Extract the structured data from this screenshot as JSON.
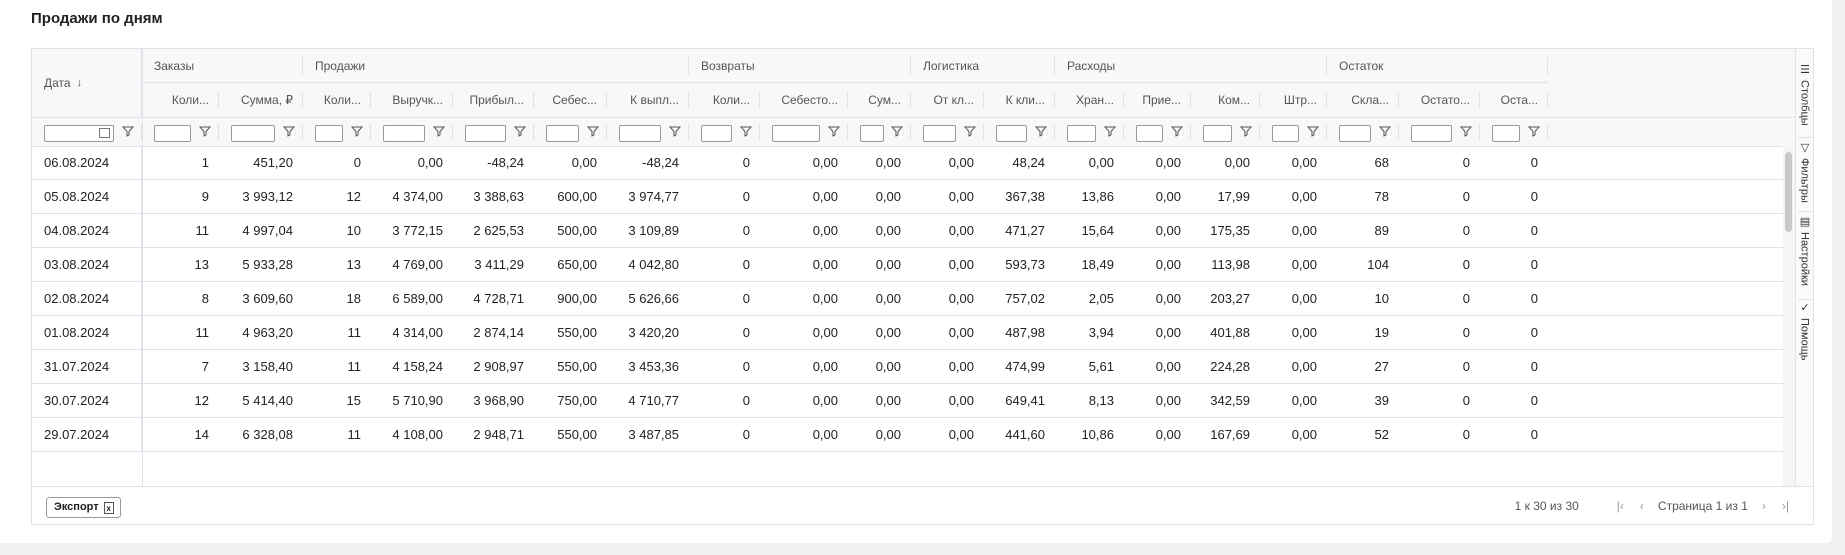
{
  "page": {
    "title": "Продажи по дням"
  },
  "groups": [
    {
      "label": "Заказы",
      "key": "orders"
    },
    {
      "label": "Продажи",
      "key": "sales"
    },
    {
      "label": "Возвраты",
      "key": "returns"
    },
    {
      "label": "Логистика",
      "key": "logistics"
    },
    {
      "label": "Расходы",
      "key": "expenses"
    },
    {
      "label": "Остаток",
      "key": "stock"
    }
  ],
  "date_column": {
    "label": "Дата",
    "sort_icon": "arrow-down-icon"
  },
  "columns": [
    {
      "label": "Коли..."
    },
    {
      "label": "Сумма, ₽"
    },
    {
      "label": "Коли..."
    },
    {
      "label": "Выручк..."
    },
    {
      "label": "Прибыл..."
    },
    {
      "label": "Себес..."
    },
    {
      "label": "К выпл..."
    },
    {
      "label": "Коли..."
    },
    {
      "label": "Себесто..."
    },
    {
      "label": "Сум..."
    },
    {
      "label": "От кл..."
    },
    {
      "label": "К кли..."
    },
    {
      "label": "Хран..."
    },
    {
      "label": "Прие..."
    },
    {
      "label": "Ком..."
    },
    {
      "label": "Штр..."
    },
    {
      "label": "Скла..."
    },
    {
      "label": "Остато..."
    },
    {
      "label": "Оста..."
    }
  ],
  "rows": [
    {
      "date": "06.08.2024",
      "v": [
        "1",
        "451,20",
        "0",
        "0,00",
        "-48,24",
        "0,00",
        "-48,24",
        "0",
        "0,00",
        "0,00",
        "0,00",
        "48,24",
        "0,00",
        "0,00",
        "0,00",
        "0,00",
        "68",
        "0",
        "0"
      ]
    },
    {
      "date": "05.08.2024",
      "v": [
        "9",
        "3 993,12",
        "12",
        "4 374,00",
        "3 388,63",
        "600,00",
        "3 974,77",
        "0",
        "0,00",
        "0,00",
        "0,00",
        "367,38",
        "13,86",
        "0,00",
        "17,99",
        "0,00",
        "78",
        "0",
        "0"
      ]
    },
    {
      "date": "04.08.2024",
      "v": [
        "11",
        "4 997,04",
        "10",
        "3 772,15",
        "2 625,53",
        "500,00",
        "3 109,89",
        "0",
        "0,00",
        "0,00",
        "0,00",
        "471,27",
        "15,64",
        "0,00",
        "175,35",
        "0,00",
        "89",
        "0",
        "0"
      ]
    },
    {
      "date": "03.08.2024",
      "v": [
        "13",
        "5 933,28",
        "13",
        "4 769,00",
        "3 411,29",
        "650,00",
        "4 042,80",
        "0",
        "0,00",
        "0,00",
        "0,00",
        "593,73",
        "18,49",
        "0,00",
        "113,98",
        "0,00",
        "104",
        "0",
        "0"
      ]
    },
    {
      "date": "02.08.2024",
      "v": [
        "8",
        "3 609,60",
        "18",
        "6 589,00",
        "4 728,71",
        "900,00",
        "5 626,66",
        "0",
        "0,00",
        "0,00",
        "0,00",
        "757,02",
        "2,05",
        "0,00",
        "203,27",
        "0,00",
        "10",
        "0",
        "0"
      ]
    },
    {
      "date": "01.08.2024",
      "v": [
        "11",
        "4 963,20",
        "11",
        "4 314,00",
        "2 874,14",
        "550,00",
        "3 420,20",
        "0",
        "0,00",
        "0,00",
        "0,00",
        "487,98",
        "3,94",
        "0,00",
        "401,88",
        "0,00",
        "19",
        "0",
        "0"
      ]
    },
    {
      "date": "31.07.2024",
      "v": [
        "7",
        "3 158,40",
        "11",
        "4 158,24",
        "2 908,97",
        "550,00",
        "3 453,36",
        "0",
        "0,00",
        "0,00",
        "0,00",
        "474,99",
        "5,61",
        "0,00",
        "224,28",
        "0,00",
        "27",
        "0",
        "0"
      ]
    },
    {
      "date": "30.07.2024",
      "v": [
        "12",
        "5 414,40",
        "15",
        "5 710,90",
        "3 968,90",
        "750,00",
        "4 710,77",
        "0",
        "0,00",
        "0,00",
        "0,00",
        "649,41",
        "8,13",
        "0,00",
        "342,59",
        "0,00",
        "39",
        "0",
        "0"
      ]
    },
    {
      "date": "29.07.2024",
      "v": [
        "14",
        "6 328,08",
        "11",
        "4 108,00",
        "2 948,71",
        "550,00",
        "3 487,85",
        "0",
        "0,00",
        "0,00",
        "0,00",
        "441,60",
        "10,86",
        "0,00",
        "167,69",
        "0,00",
        "52",
        "0",
        "0"
      ]
    }
  ],
  "sidebar": [
    {
      "label": "Столбцы",
      "icon": "columns-icon"
    },
    {
      "label": "Фильтры",
      "icon": "filter-icon"
    },
    {
      "label": "Настройки",
      "icon": "settings-icon"
    },
    {
      "label": "Помощь",
      "icon": "check-icon"
    }
  ],
  "footer": {
    "export_label": "Экспорт",
    "export_icon": "excel-icon",
    "summary": "1 к 30 из 30",
    "page_label": "Страница 1 из 1"
  }
}
